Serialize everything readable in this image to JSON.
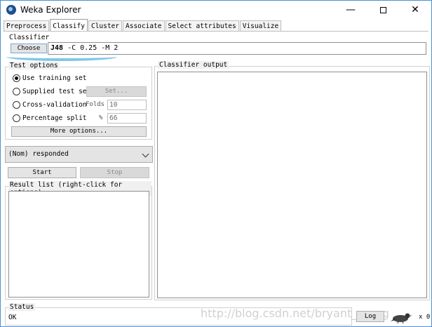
{
  "window": {
    "title": "Weka Explorer",
    "minimize_glyph": "—",
    "close_glyph": "✕"
  },
  "tabs": [
    {
      "label": "Preprocess",
      "active": false
    },
    {
      "label": "Classify",
      "active": true
    },
    {
      "label": "Cluster",
      "active": false
    },
    {
      "label": "Associate",
      "active": false
    },
    {
      "label": "Select attributes",
      "active": false
    },
    {
      "label": "Visualize",
      "active": false
    }
  ],
  "classifier": {
    "section_label": "Classifier",
    "choose_label": "Choose",
    "name": "J48",
    "options": " -C 0.25 -M 2"
  },
  "test_options": {
    "title": "Test options",
    "use_training_set": "Use training set",
    "supplied_test_set": "Supplied test set",
    "set_label": "Set...",
    "cross_validation": "Cross-validation",
    "folds_label": "Folds",
    "folds_value": "10",
    "percentage_split": "Percentage split",
    "percent_label": "%",
    "percent_value": "66",
    "more_options": "More options...",
    "selected": "use_training_set"
  },
  "class_attribute": {
    "selected": "(Nom) responded"
  },
  "actions": {
    "start": "Start",
    "stop": "Stop"
  },
  "result_list": {
    "title": "Result list (right-click for options)"
  },
  "output": {
    "title": "Classifier output"
  },
  "status": {
    "label": "Status",
    "text": "OK",
    "log_label": "Log",
    "x_count": "x 0"
  },
  "watermark": "http://blog.csdn.net/bryant_meng",
  "colors": {
    "highlight_stroke": "#7ec8e8",
    "window_border": "#4a90d9"
  }
}
